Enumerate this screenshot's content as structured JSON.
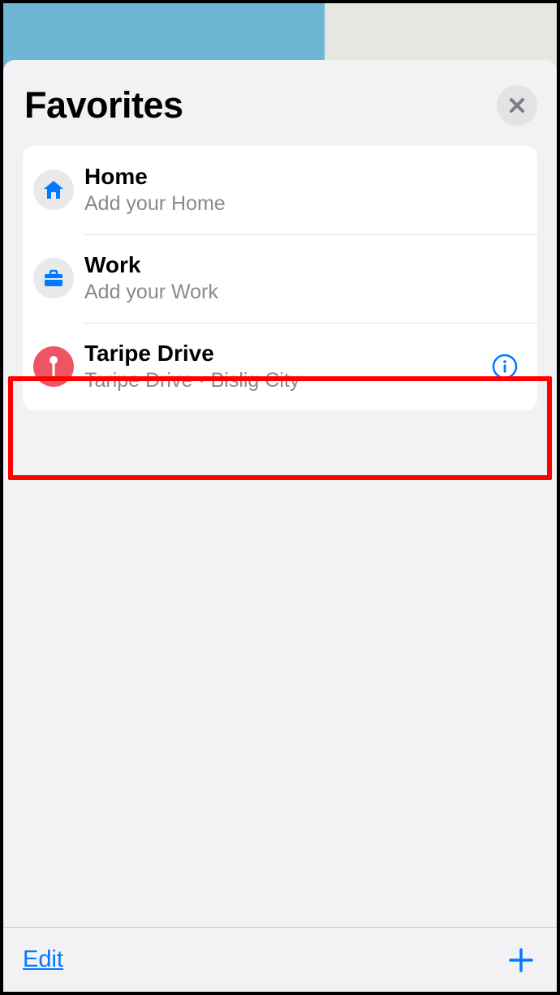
{
  "colors": {
    "accent": "#007aff",
    "highlight": "#ff0000",
    "pin": "#ed5564",
    "iconGrey": "#e9e9ec",
    "closeX": "#7d7d82"
  },
  "header": {
    "title": "Favorites"
  },
  "favorites": [
    {
      "title": "Home",
      "subtitle": "Add your Home",
      "icon": "home-icon",
      "circle": "grey",
      "showInfo": false,
      "highlighted": false
    },
    {
      "title": "Work",
      "subtitle": "Add your Work",
      "icon": "briefcase-icon",
      "circle": "grey",
      "showInfo": false,
      "highlighted": false
    },
    {
      "title": "Taripe Drive",
      "subtitle": "Taripe Drive · Bislig City",
      "icon": "pin-icon",
      "circle": "red",
      "showInfo": true,
      "highlighted": true
    }
  ],
  "toolbar": {
    "edit_label": "Edit"
  }
}
